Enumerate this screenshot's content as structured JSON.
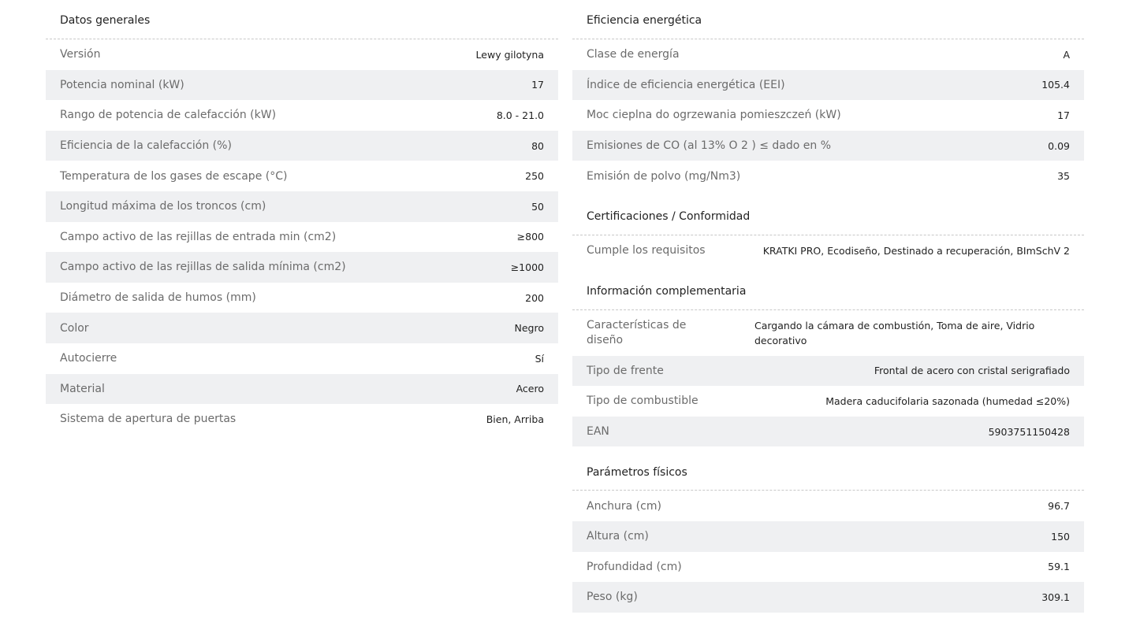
{
  "left": {
    "title": "Datos generales",
    "rows": [
      {
        "label": "Versión",
        "value": "Lewy gilotyna"
      },
      {
        "label": "Potencia nominal (kW)",
        "value": "17"
      },
      {
        "label": "Rango de potencia de calefacción (kW)",
        "value": "8.0 - 21.0"
      },
      {
        "label": "Eficiencia de la calefacción (%)",
        "value": "80"
      },
      {
        "label": "Temperatura de los gases de escape (°C)",
        "value": "250"
      },
      {
        "label": "Longitud máxima de los troncos (cm)",
        "value": "50"
      },
      {
        "label": "Campo activo de las rejillas de entrada min (cm2)",
        "value": "≥800"
      },
      {
        "label": "Campo activo de las rejillas de salida mínima (cm2)",
        "value": "≥1000"
      },
      {
        "label": "Diámetro de salida de humos (mm)",
        "value": "200"
      },
      {
        "label": "Color",
        "value": "Negro"
      },
      {
        "label": "Autocierre",
        "value": "Sí"
      },
      {
        "label": "Material",
        "value": "Acero"
      },
      {
        "label": "Sistema de apertura de puertas",
        "value": "Bien, Arriba"
      }
    ]
  },
  "right": {
    "energy": {
      "title": "Eficiencia energética",
      "rows": [
        {
          "label": "Clase de energía",
          "value": "A"
        },
        {
          "label": "Índice de eficiencia energética (EEI)",
          "value": "105.4"
        },
        {
          "label": "Moc cieplna do ogrzewania pomieszczeń (kW)",
          "value": "17"
        },
        {
          "label": "Emisiones de CO (al 13% O 2 ) ≤ dado en %",
          "value": "0.09"
        },
        {
          "label": "Emisión de polvo (mg/Nm3)",
          "value": "35"
        }
      ]
    },
    "certs": {
      "title": "Certificaciones / Conformidad",
      "rows": [
        {
          "label": "Cumple los requisitos",
          "value": "KRATKI PRO, Ecodiseño, Destinado a recuperación, BImSchV 2"
        }
      ]
    },
    "extra": {
      "title": "Información complementaria",
      "rows": [
        {
          "label": "Características de diseño",
          "value": "Cargando la cámara de combustión, Toma de aire, Vidrio decorativo"
        },
        {
          "label": "Tipo de frente",
          "value": "Frontal de acero con cristal serigrafiado"
        },
        {
          "label": "Tipo de combustible",
          "value": "Madera caducifolaria sazonada (humedad ≤20%)"
        },
        {
          "label": "EAN",
          "value": "5903751150428"
        }
      ]
    },
    "physical": {
      "title": "Parámetros físicos",
      "rows": [
        {
          "label": "Anchura (cm)",
          "value": "96.7"
        },
        {
          "label": "Altura (cm)",
          "value": "150"
        },
        {
          "label": "Profundidad (cm)",
          "value": "59.1"
        },
        {
          "label": "Peso (kg)",
          "value": "309.1"
        }
      ]
    }
  }
}
